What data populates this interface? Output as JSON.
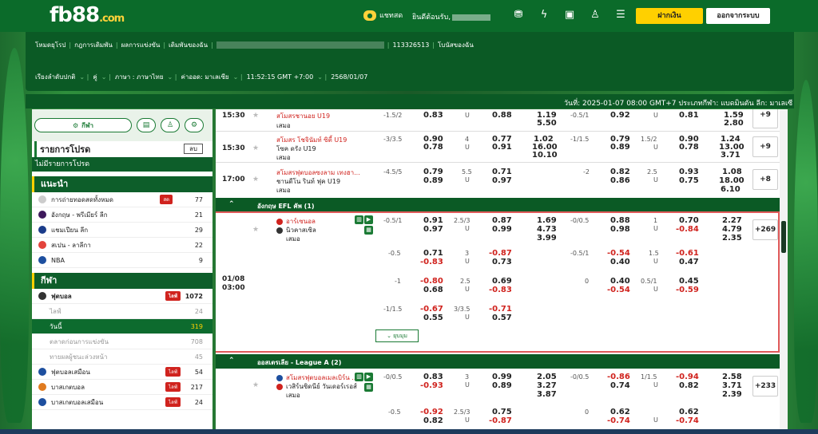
{
  "header": {
    "logo": "fb88",
    "logo_suffix": ".com",
    "chat_label": "แชทสด",
    "welcome": "ยินดีต้อนรับ,",
    "deposit_label": "ฝากเงิน",
    "logout_label": "ออกจากระบบ"
  },
  "nav": {
    "items": [
      "โหมดยุโรป",
      "กฎการเดิมพัน",
      "ผลการแข่งขัน",
      "เดิมพันของฉัน"
    ],
    "account_id": "113326513",
    "extra": "โบนัสของฉัน",
    "settings": [
      "เรียงลำดับปกติ",
      "คู่",
      "ภาษา : ภาษาไทย",
      "ค่าออด: มาเลเซีย",
      "11:52:15 GMT +7:00",
      "2568/01/07"
    ]
  },
  "datebar": "วันที่: 2025-01-07 08:00 GMT+7 ประเภทกีฬา: แบดมินตัน ลีก: มาเลเซี",
  "sidebar": {
    "main_tab": "กีฬา",
    "betslip_title": "รายการโปรด",
    "clear_label": "ลบ",
    "empty": "ไม่มีรายการโปรด",
    "recommend_title": "แนะนำ",
    "recommend": [
      {
        "name": "การถ่ายทอดสดทั้งหมด",
        "badge": "สด",
        "count": "77"
      },
      {
        "name": "อังกฤษ - พรีเมียร์ ลีก",
        "count": "21"
      },
      {
        "name": "แชมเปียน ลีก",
        "count": "29"
      },
      {
        "name": "สเปน - ลาลีกา",
        "count": "22"
      },
      {
        "name": "NBA",
        "count": "9"
      }
    ],
    "sports_title": "กีฬา",
    "football": {
      "name": "ฟุตบอล",
      "badge": "ไลฟ์",
      "count": "1072"
    },
    "sub": [
      {
        "name": "ไลฟ์",
        "count": "24"
      },
      {
        "name": "วันนี้",
        "count": "319",
        "active": true
      },
      {
        "name": "ตลาดก่อนการแข่งขัน",
        "count": "708"
      },
      {
        "name": "ทายผลผู้ชนะล่วงหน้า",
        "count": "45"
      }
    ],
    "sports": [
      {
        "name": "ฟุตบอลเสมือน",
        "badge": "ไลฟ์",
        "count": "54"
      },
      {
        "name": "บาสเกตบอล",
        "badge": "ไลฟ์",
        "count": "217"
      },
      {
        "name": "บาสเกตบอลเสมือน",
        "badge": "ไลฟ์",
        "count": "24"
      }
    ]
  },
  "matches": {
    "m1": {
      "time": "15:30",
      "home": "สโมสรชานอย U19",
      "draw": "เสมอ",
      "h1": "-1.5/2",
      "o1": "0.83",
      "u1": "U",
      "o2": "0.88",
      "x1": "1.19",
      "x2": "5.50",
      "h2": "-0.5/1",
      "o3": "0.92",
      "u2": "U",
      "o4": "0.81",
      "y1": "1.59",
      "y2": "2.80",
      "more": "+9"
    },
    "m2": {
      "time": "15:30",
      "home": "สโมสร โชจินัมท์ ซิตี้ U19",
      "away": "โซค ดรัง U19",
      "draw": "เสมอ",
      "h1": "-3/3.5",
      "a": "0.90",
      "b": "0.78",
      "g": "4",
      "u": "U",
      "c": "0.77",
      "d": "0.91",
      "x1": "1.02",
      "x2": "16.00",
      "x3": "10.10",
      "h2": "-1/1.5",
      "e": "0.79",
      "f": "0.89",
      "g2": "1.5/2",
      "u2": "U",
      "h": "0.90",
      "i": "0.78",
      "y1": "1.24",
      "y2": "13.00",
      "y3": "3.71",
      "more": "+9"
    },
    "m3": {
      "time": "17:00",
      "home": "สโมสรฟุตบอลซงลาม เทงฮา...",
      "away": "ชานดีโน รินท์ ฟุค U19",
      "draw": "เสมอ",
      "h1": "-4.5/5",
      "a": "0.79",
      "b": "0.89",
      "g": "5.5",
      "u": "U",
      "c": "0.71",
      "d": "0.97",
      "h2": "-2",
      "e": "0.82",
      "f": "0.86",
      "g2": "2.5",
      "u2": "U",
      "h": "0.93",
      "i": "0.75",
      "y1": "1.08",
      "y2": "18.00",
      "y3": "6.10",
      "more": "+8"
    }
  },
  "league1": "อังกฤษ EFL คัพ (1)",
  "feature": {
    "date": "01/08",
    "time": "03:00",
    "home": "อาร์เซนอล",
    "away": "นิวคาสเซิล",
    "draw": "เสมอ",
    "more": "+269",
    "lines": [
      {
        "h": "-0.5/1",
        "a": "0.91",
        "b": "0.97",
        "g": "2.5/3",
        "u": "U",
        "c": "0.87",
        "d": "0.99",
        "x1": "1.69",
        "x2": "4.73",
        "x3": "3.99",
        "h2": "-0/0.5",
        "e": "0.88",
        "f": "0.98",
        "g2": "1",
        "u2": "U",
        "i": "0.70",
        "j": "-0.84",
        "y1": "2.27",
        "y2": "4.79",
        "y3": "2.35"
      },
      {
        "h": "-0.5",
        "a": "0.71",
        "b": "-0.83",
        "g": "3",
        "u": "U",
        "c": "-0.87",
        "d": "0.73",
        "h2": "-0.5/1",
        "e": "-0.54",
        "f": "0.40",
        "g2": "1.5",
        "u2": "U",
        "i": "-0.61",
        "j": "0.47"
      },
      {
        "h": "-1",
        "a": "-0.80",
        "b": "0.68",
        "g": "2.5",
        "u": "U",
        "c": "0.69",
        "d": "-0.83",
        "h2": "0",
        "e": "0.40",
        "f": "-0.54",
        "g2": "0.5/1",
        "u2": "U",
        "i": "0.45",
        "j": "-0.59"
      },
      {
        "h": "-1/1.5",
        "a": "-0.67",
        "b": "0.55",
        "g": "3/3.5",
        "u": "U",
        "c": "-0.71",
        "d": "0.57"
      }
    ],
    "collapse": "ยุบมุม"
  },
  "league2": "ออสเตรเลีย - League A (2)",
  "m4": {
    "home": "สโมสรฟุตบอลเมลเบิร์น ...",
    "away": "เวสิร์นซิดนีย์ วันเดอร์เรอส์",
    "draw": "เสมอ",
    "h1": "-0/0.5",
    "a": "0.83",
    "b": "-0.93",
    "g": "3",
    "u": "U",
    "c": "0.99",
    "d": "0.89",
    "x1": "2.05",
    "x2": "3.27",
    "x3": "3.87",
    "h2": "-0/0.5",
    "e": "-0.86",
    "f": "0.74",
    "g2": "1/1.5",
    "u2": "U",
    "i": "-0.94",
    "j": "0.82",
    "y1": "2.58",
    "y2": "3.71",
    "y3": "2.39",
    "more": "+233"
  },
  "m5": {
    "h1": "-0.5",
    "a": "-0.92",
    "b": "0.82",
    "g": "2.5/3",
    "u": "U",
    "c": "0.75",
    "d": "-0.87",
    "h2": "0",
    "e": "0.62",
    "f": "-0.74",
    "u2": "U",
    "i": "0.62",
    "j": "-0.74"
  }
}
